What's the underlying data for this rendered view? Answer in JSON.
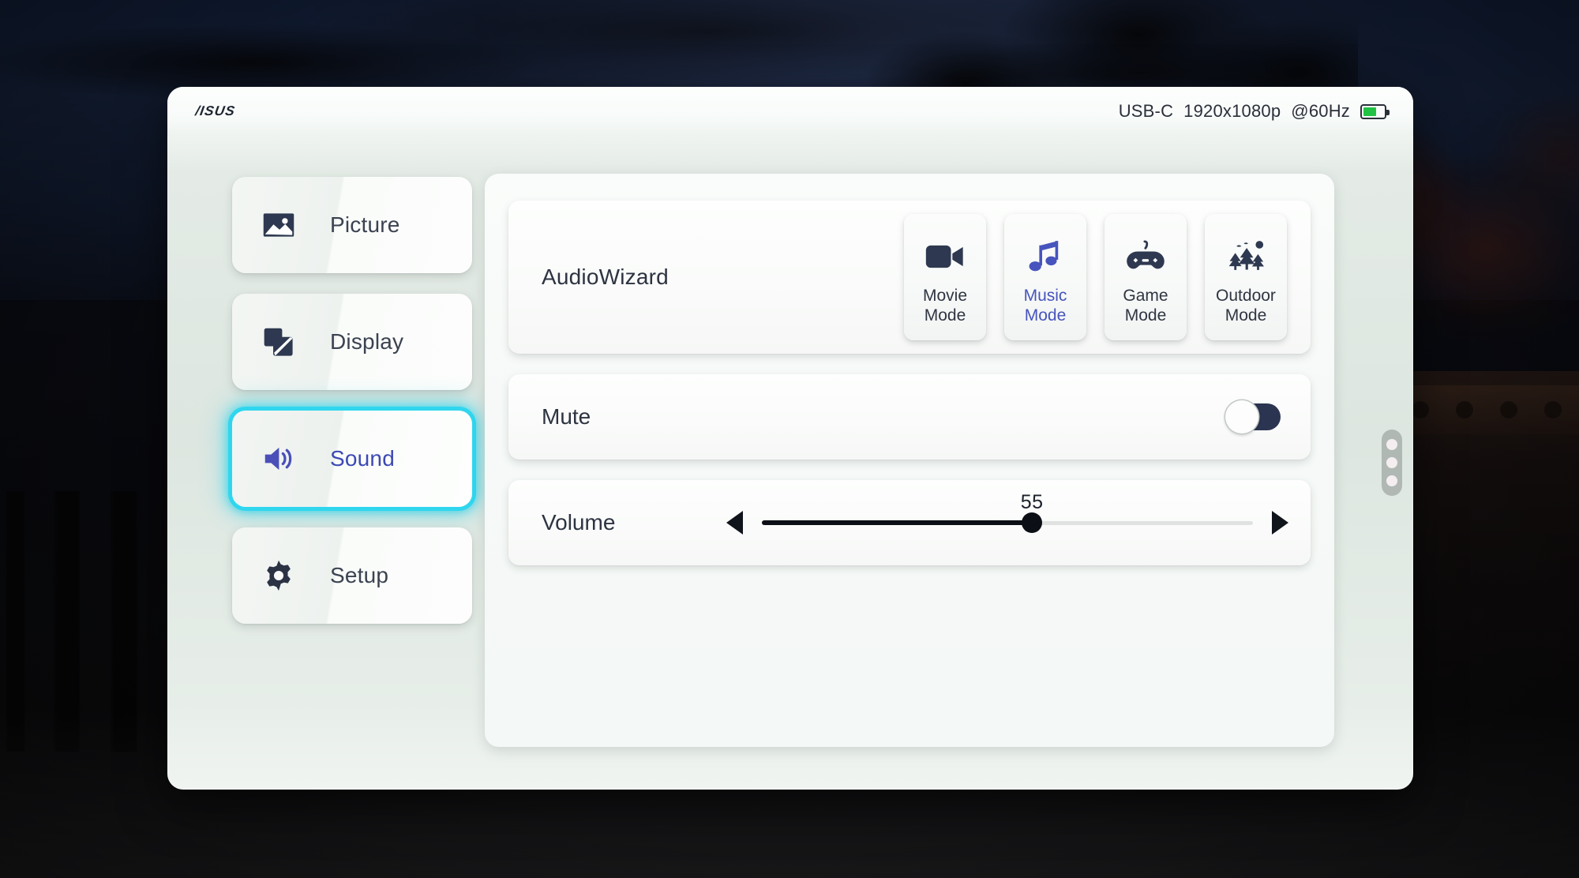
{
  "backdrop": {
    "scene": "dark-night-park-bridge-photo"
  },
  "osd": {
    "brand": "/ISUS",
    "status": {
      "source": "USB-C",
      "resolution": "1920x1080p",
      "refresh": "@60Hz",
      "battery_icon": "battery-icon",
      "battery_level_pct": 64,
      "battery_color": "#22c245"
    },
    "sidebar": {
      "items": [
        {
          "label": "Picture",
          "icon": "image-icon",
          "selected": false
        },
        {
          "label": "Display",
          "icon": "display-icon",
          "selected": false
        },
        {
          "label": "Sound",
          "icon": "speaker-icon",
          "selected": true
        },
        {
          "label": "Setup",
          "icon": "gear-icon",
          "selected": false
        }
      ],
      "selected_glow_color": "#2fd6ee",
      "selected_label_color": "#3c49b4"
    },
    "content": {
      "audiowizard": {
        "label": "AudioWizard",
        "modes": [
          {
            "label": "Movie\nMode",
            "icon": "video-camera-icon",
            "active": false
          },
          {
            "label": "Music\nMode",
            "icon": "music-note-icon",
            "active": true
          },
          {
            "label": "Game\nMode",
            "icon": "gamepad-icon",
            "active": false
          },
          {
            "label": "Outdoor\nMode",
            "icon": "trees-icon",
            "active": false
          }
        ],
        "active_color": "#4754bd"
      },
      "mute": {
        "label": "Mute",
        "state": "off",
        "toggle_track_color": "#2b3450"
      },
      "volume": {
        "label": "Volume",
        "value": "55",
        "value_number": 55,
        "min": 0,
        "max": 100,
        "fill_percent": 55,
        "decrease_icon": "triangle-left-icon",
        "increase_icon": "triangle-right-icon"
      },
      "page_indicator": {
        "dots": 3,
        "icon": "page-dots-icon"
      }
    }
  }
}
